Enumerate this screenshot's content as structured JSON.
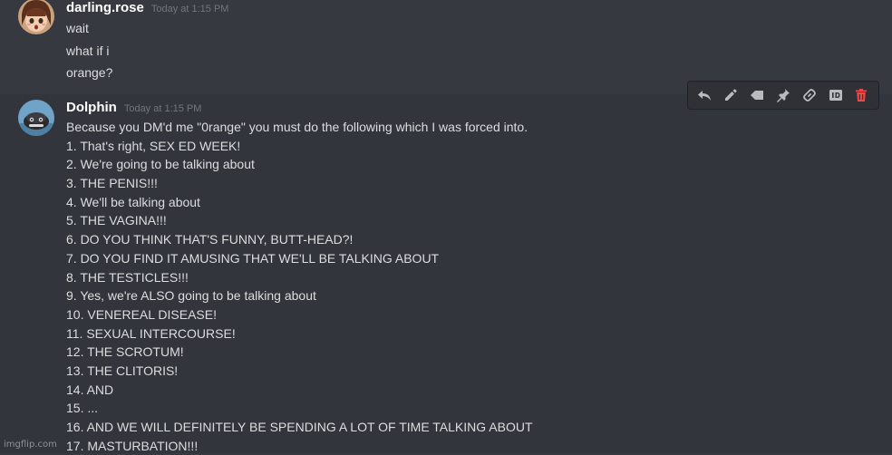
{
  "messages": [
    {
      "username": "darling.rose",
      "timestamp": "Today at 1:15 PM",
      "lines": [
        "wait",
        "what if i",
        "orange?"
      ]
    },
    {
      "username": "Dolphin",
      "timestamp": "Today at 1:15 PM",
      "lines": [
        "Because you DM'd me \"0range\" you must do the following which I was forced into.",
        "1. That's right, SEX ED WEEK!",
        "2. We're going to be talking about",
        "3. THE PENIS!!!",
        "4. We'll be talking about",
        "5. THE VAGINA!!!",
        "6. DO YOU THINK THAT'S FUNNY, BUTT-HEAD?!",
        "7. DO YOU FIND IT AMUSING THAT WE'LL BE TALKING ABOUT",
        "8. THE TESTICLES!!!",
        "9. Yes, we're ALSO going to be talking about",
        "10. VENEREAL DISEASE!",
        "11. SEXUAL INTERCOURSE!",
        "12. THE SCROTUM!",
        "13. THE CLITORIS!",
        "14. AND",
        "15. ...",
        "16. AND WE WILL DEFINITELY BE SPENDING A LOT OF TIME TALKING ABOUT",
        "17. MASTURBATION!!!"
      ]
    }
  ],
  "toolbar_icons": [
    "reply-icon",
    "edit-icon",
    "tag-icon",
    "pin-icon",
    "link-icon",
    "id-icon",
    "delete-icon"
  ],
  "colors": {
    "background": "#36393f",
    "hover_background": "#32353b",
    "username": "#ffffff",
    "text": "#dcddde",
    "timestamp": "#72767d",
    "delete": "#f04747"
  },
  "watermark": "imgflip.com"
}
